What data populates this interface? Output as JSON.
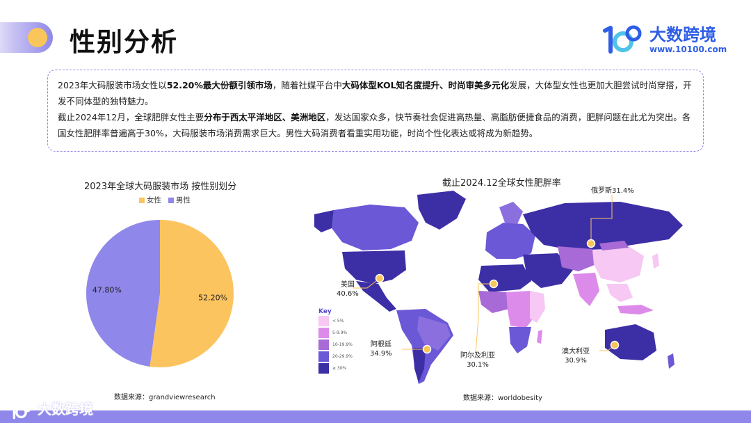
{
  "header": {
    "title": "性别分析",
    "brand_name": "大数跨境",
    "brand_url": "www.10100.com",
    "brand_logo": "1C00"
  },
  "description": {
    "p1": [
      {
        "t": "2023年大码服装市场女性以",
        "b": false
      },
      {
        "t": "52.20%最大份额引领市场",
        "b": true
      },
      {
        "t": "，随着社媒平台中",
        "b": false
      },
      {
        "t": "大码体型KOL知名度提升、时尚审美多元化",
        "b": true
      },
      {
        "t": "发展，大体型女性也更加大胆尝试时尚穿搭，开发不同体型的独特魅力。",
        "b": false
      }
    ],
    "p2": [
      {
        "t": "截止2024年12月，全球肥胖女性主要",
        "b": false
      },
      {
        "t": "分布于西太平洋地区、美洲地区",
        "b": true
      },
      {
        "t": "，发达国家众多，快节奏社会促进高热量、高脂肪便捷食品的消费，肥胖问题在此尤为突出。各国女性肥胖率普遍高于30%，大码服装市场消费需求巨大。男性大码消费者看重实用功能，时尚个性化表达或将成为新趋势。",
        "b": false
      }
    ]
  },
  "pie": {
    "source": "数据来源：grandviewresearch",
    "colors": {
      "female": "#fcc45f",
      "male": "#8f87ea"
    }
  },
  "chart_data": [
    {
      "type": "pie",
      "title": "2023年全球大码服装市场 按性别划分",
      "categories": [
        "女性",
        "男性"
      ],
      "values": [
        52.2,
        47.8
      ],
      "labels": [
        "52.20%",
        "47.80%"
      ],
      "legend": "top"
    },
    {
      "type": "map",
      "title": "截止2024.12全球女性肥胖率",
      "key_title": "Key",
      "key": [
        "< 5%",
        "5-9.9%",
        "10-19.9%",
        "20-29.9%",
        "≥ 30%"
      ],
      "key_colors": [
        "#f6c8f3",
        "#dd8bea",
        "#a76ad6",
        "#6a58d6",
        "#3c2fa6"
      ],
      "callouts": [
        {
          "country": "俄罗斯",
          "value": "31.4%"
        },
        {
          "country": "美国",
          "value": "40.6%"
        },
        {
          "country": "阿根廷",
          "value": "34.9%"
        },
        {
          "country": "阿尔及利亚",
          "value": "30.1%"
        },
        {
          "country": "澳大利亚",
          "value": "30.9%"
        }
      ],
      "source": "数据来源：worldobesity"
    }
  ],
  "footer": {
    "brand": "大数跨境"
  }
}
